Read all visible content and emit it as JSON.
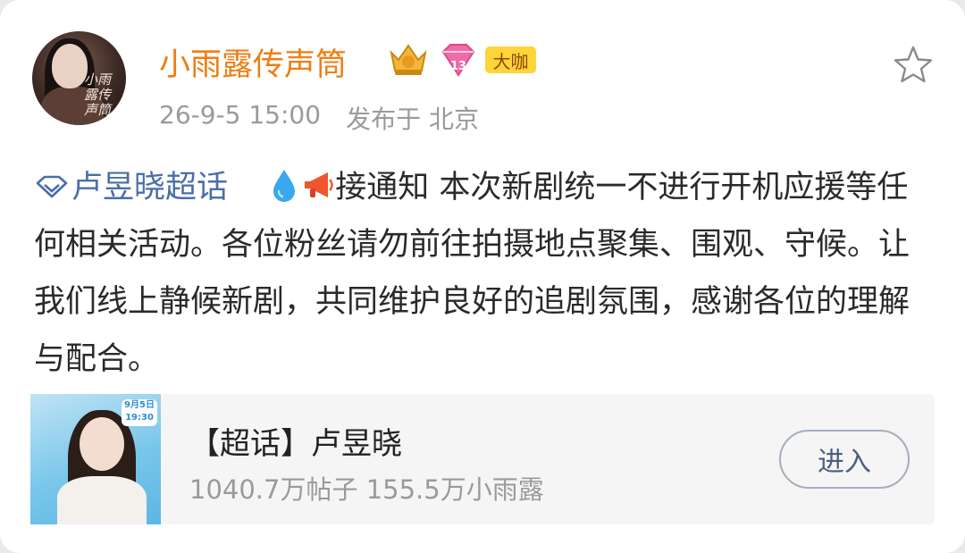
{
  "post": {
    "author": {
      "name": "小雨露传声筒",
      "avatar_text": "小雨露传声筒",
      "badges": [
        {
          "icon": "crown-level-icon",
          "label": ""
        },
        {
          "icon": "gem-level-icon",
          "label": "13"
        },
        {
          "icon": "vip-badge",
          "label": "大咖"
        }
      ]
    },
    "timestamp": "26-9-5 15:00",
    "location": "发布于 北京",
    "favorite_icon": "star-outline-icon",
    "topic_label": "卢昱晓超话",
    "content": "接通知 本次新剧统一不进行开机应援等任何相关活动。各位粉丝请勿前往拍摄地点聚集、围观、守候。让我们线上静候新剧，共同维护良好的追剧氛围，感谢各位的理解与配合。",
    "emoji": [
      "droplet-emoji",
      "megaphone-emoji"
    ]
  },
  "share_card": {
    "title": "【超话】卢昱晓",
    "stats": "1040.7万帖子 155.5万小雨露",
    "button_label": "进入",
    "thumbnail_date": "9月5日\n19:30"
  },
  "colors": {
    "author_name": "#f07d12",
    "topic_link": "#4b6ea8",
    "meta_text": "#9a9a9a"
  }
}
